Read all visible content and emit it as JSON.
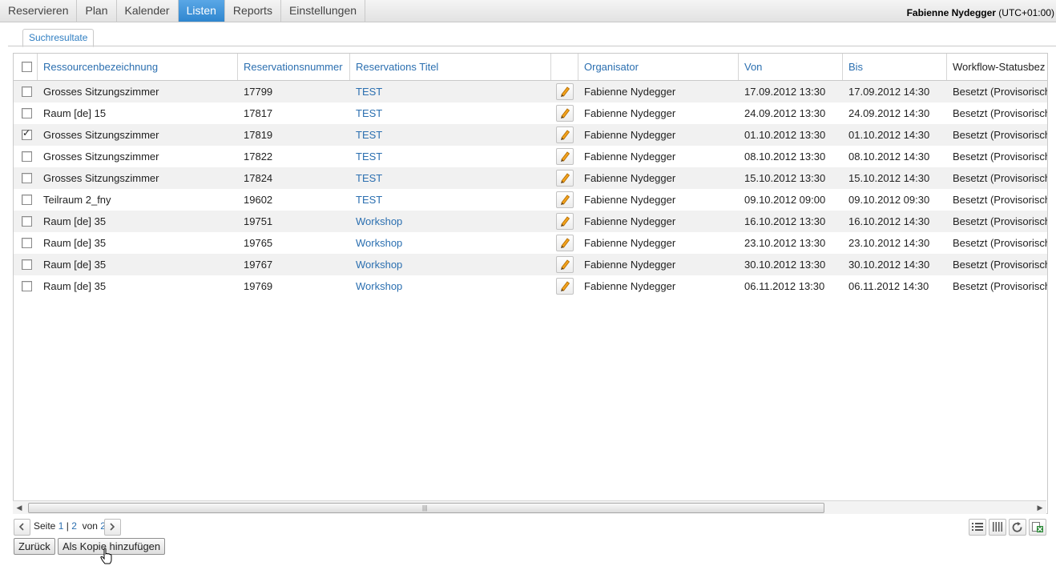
{
  "nav": {
    "items": [
      {
        "label": "Reservieren"
      },
      {
        "label": "Plan"
      },
      {
        "label": "Kalender"
      },
      {
        "label": "Listen"
      },
      {
        "label": "Reports"
      },
      {
        "label": "Einstellungen"
      }
    ],
    "active": "Listen"
  },
  "user": {
    "name": "Fabienne Nydegger",
    "timezone": "(UTC+01:00)"
  },
  "tab": {
    "label": "Suchresultate"
  },
  "table": {
    "columns": [
      "Ressourcenbezeichnung",
      "Reservationsnummer",
      "Reservations Titel",
      "",
      "Organisator",
      "Von",
      "Bis",
      "Workflow-Statusbez"
    ],
    "rows": [
      {
        "resource": "Grosses Sitzungszimmer",
        "number": "17799",
        "title": "TEST",
        "organizer": "Fabienne Nydegger",
        "from": "17.09.2012 13:30",
        "to": "17.09.2012 14:30",
        "status": "Besetzt (Provisorisch",
        "checked": false
      },
      {
        "resource": "Raum [de] 15",
        "number": "17817",
        "title": "TEST",
        "organizer": "Fabienne Nydegger",
        "from": "24.09.2012 13:30",
        "to": "24.09.2012 14:30",
        "status": "Besetzt (Provisorisch",
        "checked": false
      },
      {
        "resource": "Grosses Sitzungszimmer",
        "number": "17819",
        "title": "TEST",
        "organizer": "Fabienne Nydegger",
        "from": "01.10.2012 13:30",
        "to": "01.10.2012 14:30",
        "status": "Besetzt (Provisorisch",
        "checked": true
      },
      {
        "resource": "Grosses Sitzungszimmer",
        "number": "17822",
        "title": "TEST",
        "organizer": "Fabienne Nydegger",
        "from": "08.10.2012 13:30",
        "to": "08.10.2012 14:30",
        "status": "Besetzt (Provisorisch",
        "checked": false
      },
      {
        "resource": "Grosses Sitzungszimmer",
        "number": "17824",
        "title": "TEST",
        "organizer": "Fabienne Nydegger",
        "from": "15.10.2012 13:30",
        "to": "15.10.2012 14:30",
        "status": "Besetzt (Provisorisch",
        "checked": false
      },
      {
        "resource": "Teilraum 2_fny",
        "number": "19602",
        "title": "TEST",
        "organizer": "Fabienne Nydegger",
        "from": "09.10.2012 09:00",
        "to": "09.10.2012 09:30",
        "status": "Besetzt (Provisorisch",
        "checked": false
      },
      {
        "resource": "Raum [de] 35",
        "number": "19751",
        "title": "Workshop",
        "organizer": "Fabienne Nydegger",
        "from": "16.10.2012 13:30",
        "to": "16.10.2012 14:30",
        "status": "Besetzt (Provisorisch",
        "checked": false
      },
      {
        "resource": "Raum [de] 35",
        "number": "19765",
        "title": "Workshop",
        "organizer": "Fabienne Nydegger",
        "from": "23.10.2012 13:30",
        "to": "23.10.2012 14:30",
        "status": "Besetzt (Provisorisch",
        "checked": false
      },
      {
        "resource": "Raum [de] 35",
        "number": "19767",
        "title": "Workshop",
        "organizer": "Fabienne Nydegger",
        "from": "30.10.2012 13:30",
        "to": "30.10.2012 14:30",
        "status": "Besetzt (Provisorisch",
        "checked": false
      },
      {
        "resource": "Raum [de] 35",
        "number": "19769",
        "title": "Workshop",
        "organizer": "Fabienne Nydegger",
        "from": "06.11.2012 13:30",
        "to": "06.11.2012 14:30",
        "status": "Besetzt (Provisorisch",
        "checked": false
      }
    ]
  },
  "pager": {
    "page_label": "Seite",
    "current": "1",
    "separator": "|",
    "next_page": "2",
    "of_label": "von",
    "total": "2"
  },
  "buttons": {
    "back": "Zurück",
    "add_copy": "Als Kopie hinzufügen"
  },
  "icons": {
    "edit": "pencil-icon",
    "prev": "chevron-left-icon",
    "next": "chevron-right-icon",
    "list": "list-view-icon",
    "columns": "columns-icon",
    "refresh": "refresh-icon",
    "export": "excel-export-icon"
  },
  "colors": {
    "accent": "#2f86cf",
    "link": "#2b6fb0",
    "row_alt": "#f1f1f1"
  }
}
